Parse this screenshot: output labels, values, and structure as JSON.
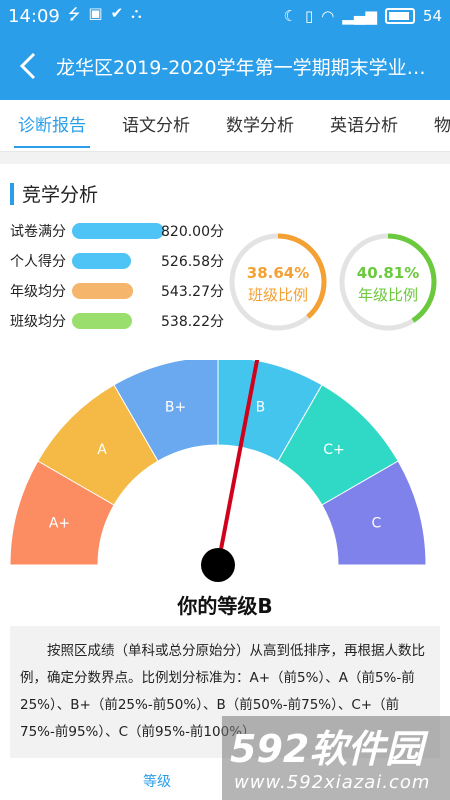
{
  "status": {
    "time": "14:09",
    "battery": "54"
  },
  "header": {
    "back_icon": "chevron-left-icon",
    "title": "龙华区2019-2020学年第一学期期末学业质.."
  },
  "tabs": [
    {
      "label": "诊断报告",
      "active": true
    },
    {
      "label": "语文分析",
      "active": false
    },
    {
      "label": "数学分析",
      "active": false
    },
    {
      "label": "英语分析",
      "active": false
    },
    {
      "label": "物",
      "active": false
    }
  ],
  "section": {
    "title": "竞学分析"
  },
  "scores": [
    {
      "label": "试卷满分",
      "value": "820.00分",
      "color": "#4ec3f6",
      "fraction": 1.0
    },
    {
      "label": "个人得分",
      "value": "526.58分",
      "color": "#4ec3f6",
      "fraction": 0.642
    },
    {
      "label": "年级均分",
      "value": "543.27分",
      "color": "#f5b56a",
      "fraction": 0.662
    },
    {
      "label": "班级均分",
      "value": "538.22分",
      "color": "#9adf6d",
      "fraction": 0.656
    }
  ],
  "rings": [
    {
      "percent_text": "38.64%",
      "label": "班级比例",
      "fraction": 0.3864,
      "color": "#f5a033"
    },
    {
      "percent_text": "40.81%",
      "label": "年级比例",
      "fraction": 0.4081,
      "color": "#6bc93d"
    }
  ],
  "gauge": {
    "segments": [
      {
        "label": "A+",
        "color": "#fc8c62"
      },
      {
        "label": "A",
        "color": "#f5ba45"
      },
      {
        "label": "B+",
        "color": "#6aa8f0"
      },
      {
        "label": "B",
        "color": "#43c5ee"
      },
      {
        "label": "C+",
        "color": "#2fd9c5"
      },
      {
        "label": "C",
        "color": "#7e82ea"
      }
    ],
    "needle_value": 0.56,
    "needle_color": "#d0021b"
  },
  "result": {
    "grade_text": "你的等级B"
  },
  "note": {
    "text": "按照区成绩（单科或总分原始分）从高到低排序，再根据人数比例，确定分数界点。比例划分标准为：A+（前5%）、A（前5%-前25%）、B+（前25%-前50%）、B（前50%-前75%）、C+（前75%-前95%）、C（前95%-前100%）"
  },
  "bottom": {
    "tab_label": "等级"
  },
  "watermark": {
    "line1": "592软件园",
    "line2": "www.592xiazai.com"
  }
}
